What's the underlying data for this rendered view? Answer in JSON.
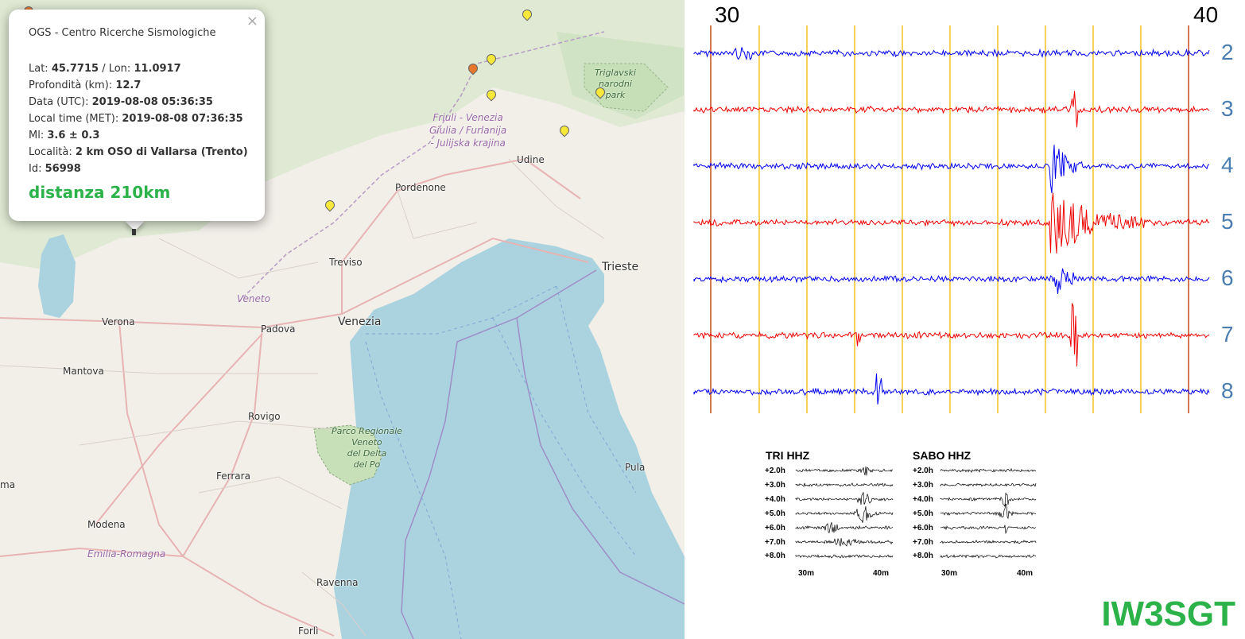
{
  "popup": {
    "close": "×",
    "header": "OGS - Centro Ricerche Sismologiche",
    "lat_label": "Lat:",
    "lat": "45.7715",
    "lon_label": "/ Lon:",
    "lon": "11.0917",
    "depth_label": "Profondità (km):",
    "depth": "12.7",
    "date_label": "Data (UTC):",
    "date": "2019-08-08 05:36:35",
    "local_label": "Local time (MET):",
    "local": "2019-08-08 07:36:35",
    "ml_label": "Ml:",
    "ml": "3.6 ± 0.3",
    "loc_label": "Località:",
    "loc": "2 km OSO di Vallarsa (Trento)",
    "id_label": "Id:",
    "id": "56998",
    "distance": "distanza 210km"
  },
  "map": {
    "places": {
      "verona": "Verona",
      "padova": "Padova",
      "venezia": "Venezia",
      "treviso": "Treviso",
      "pordenone": "Pordenone",
      "udine": "Udine",
      "trieste": "Trieste",
      "mantova": "Mantova",
      "rovigo": "Rovigo",
      "ferrara": "Ferrara",
      "modena": "Modena",
      "ravenna": "Ravenna",
      "forli": "Forlì",
      "pula": "Pula",
      "ma": "ma"
    },
    "regions": {
      "veneto": "Veneto",
      "emilia": "Emilia-Romagna"
    },
    "friuli": [
      "Friuli - Venezia",
      "Giulia / Furlanija",
      "- Julijska krajina"
    ],
    "triglav": [
      "Triglavski",
      "narodni",
      "park"
    ],
    "delta": [
      "Parco Regionale",
      "Veneto",
      "del Delta",
      "del Po"
    ]
  },
  "seismo": {
    "axis_left": "30",
    "axis_right": "40",
    "traces": [
      "2",
      "3",
      "4",
      "5",
      "6",
      "7",
      "8"
    ],
    "trace_colors": [
      "#0000ee",
      "#ee0000",
      "#0000ee",
      "#ee0000",
      "#0000ee",
      "#ee0000",
      "#0000ee"
    ],
    "callsign": "IW3SGT",
    "tri": {
      "title": "TRI HHZ",
      "rows": [
        "+2.0h",
        "+3.0h",
        "+4.0h",
        "+5.0h",
        "+6.0h",
        "+7.0h",
        "+8.0h"
      ],
      "x_left": "30m",
      "x_right": "40m"
    },
    "sabo": {
      "title": "SABO HHZ",
      "rows": [
        "+2.0h",
        "+3.0h",
        "+4.0h",
        "+5.0h",
        "+6.0h",
        "+7.0h",
        "+8.0h"
      ],
      "x_left": "30m",
      "x_right": "40m"
    }
  }
}
